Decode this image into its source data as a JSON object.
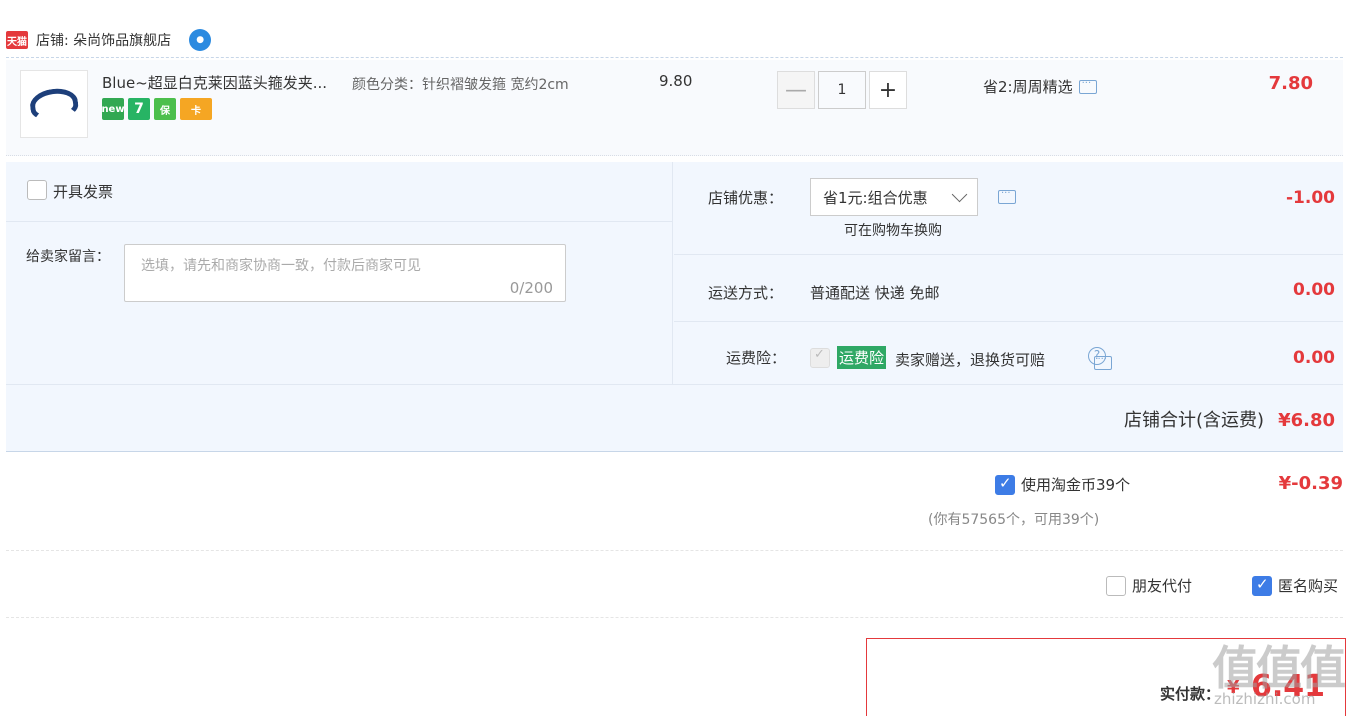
{
  "shop": {
    "tmall_badge": "天猫",
    "label": "店铺: 朵尚饰品旗舰店",
    "wangwang_icon": "wangwang-chat-icon"
  },
  "item": {
    "title": "Blue~超显白克莱因蓝头箍发夹...",
    "badges": [
      "new",
      "7",
      "保",
      "卡"
    ],
    "sku": "颜色分类：针织褶皱发箍 宽约2cm",
    "unit_price": "9.80",
    "quantity": "1",
    "minus": "—",
    "plus": "+",
    "discount_note": "省2:周周精选",
    "total": "7.80"
  },
  "invoice": {
    "label": "开具发票"
  },
  "message": {
    "label": "给卖家留言：",
    "placeholder": "选填，请先和商家协商一致，付款后商家可见",
    "counter": "0/200"
  },
  "store_coupon": {
    "label": "店铺优惠：",
    "selected": "省1元:组合优惠",
    "note": "可在购物车换购",
    "amount": "-1.00"
  },
  "shipping": {
    "label": "运送方式：",
    "value": "普通配送 快递 免邮",
    "amount": "0.00"
  },
  "insurance": {
    "label": "运费险：",
    "tag": "运费险",
    "value": "卖家赠送，退换货可赔",
    "amount": "0.00"
  },
  "store_total": {
    "label": "店铺合计(含运费)",
    "amount": "¥6.80"
  },
  "coins": {
    "label": "使用淘金币39个",
    "note": "(你有57565个，可用39个)",
    "amount": "¥-0.39"
  },
  "friend_pay": {
    "label": "朋友代付"
  },
  "anonymous": {
    "label": "匿名购买"
  },
  "payment": {
    "label": "实付款：",
    "yen": "¥",
    "amount": "6.41"
  },
  "watermark": {
    "main": "值值值",
    "sub": "zhizhizhi.com"
  },
  "colors": {
    "accent": "#e4393c",
    "panel": "#f2f7fe",
    "checkbox": "#3d7ce6",
    "insurance_tag": "#2fa865"
  }
}
